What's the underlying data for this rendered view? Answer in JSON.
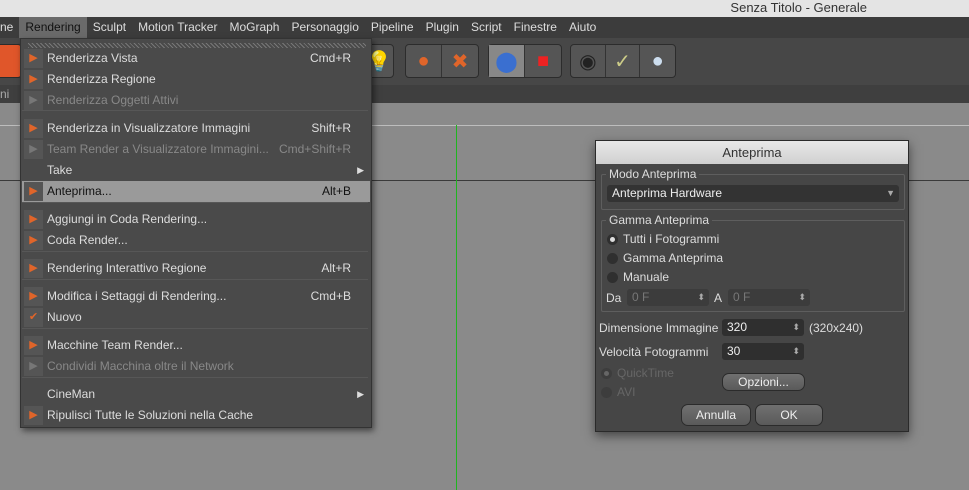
{
  "window": {
    "title": "Senza Titolo - Generale"
  },
  "menubar": [
    "ne",
    "Rendering",
    "Sculpt",
    "Motion Tracker",
    "MoGraph",
    "Personaggio",
    "Pipeline",
    "Plugin",
    "Script",
    "Finestre",
    "Aiuto"
  ],
  "left_tab": "ni",
  "menu": {
    "items": [
      {
        "label": "Renderizza Vista",
        "shortcut": "Cmd+R",
        "icon": "render-view-icon"
      },
      {
        "label": "Renderizza Regione",
        "shortcut": "",
        "icon": "render-region-icon"
      },
      {
        "label": "Renderizza Oggetti Attivi",
        "shortcut": "",
        "icon": "render-active-objects-icon",
        "disabled": true
      },
      {
        "label": "Renderizza in Visualizzatore Immagini",
        "shortcut": "Shift+R",
        "icon": "render-picture-viewer-icon"
      },
      {
        "label": "Team Render  a Visualizzatore Immagini...",
        "shortcut": "Cmd+Shift+R",
        "icon": "team-render-icon",
        "disabled": true
      },
      {
        "label": "Take",
        "shortcut": "",
        "submenu": true
      },
      {
        "label": "Anteprima...",
        "shortcut": "Alt+B",
        "icon": "preview-icon",
        "highlighted": true
      },
      {
        "label": "Aggiungi in Coda Rendering...",
        "shortcut": "",
        "icon": "add-render-queue-icon"
      },
      {
        "label": "Coda Render...",
        "shortcut": "",
        "icon": "render-queue-icon"
      },
      {
        "label": "Rendering Interattivo Regione",
        "shortcut": "Alt+R",
        "icon": "interactive-render-region-icon"
      },
      {
        "label": "Modifica i Settaggi di Rendering...",
        "shortcut": "Cmd+B",
        "icon": "render-settings-icon"
      },
      {
        "label": "Nuovo",
        "shortcut": "",
        "icon": "checkmark-icon"
      },
      {
        "label": "Macchine Team Render...",
        "shortcut": "",
        "icon": "team-render-machines-icon"
      },
      {
        "label": "Condividi Macchina oltre il Network",
        "shortcut": "",
        "icon": "share-machine-icon",
        "disabled": true
      },
      {
        "label": "CineMan",
        "shortcut": "",
        "submenu": true
      },
      {
        "label": "Ripulisci Tutte le Soluzioni nella Cache",
        "shortcut": "",
        "icon": "flush-cache-icon"
      }
    ]
  },
  "dialog": {
    "title": "Anteprima",
    "mode_group": "Modo Anteprima",
    "mode_value": "Anteprima Hardware",
    "range_group": "Gamma Anteprima",
    "range_options": [
      "Tutti i Fotogrammi",
      "Gamma Anteprima",
      "Manuale"
    ],
    "range_selected": 0,
    "from_label": "Da",
    "from_value": "0 F",
    "to_label": "A",
    "to_value": "0 F",
    "size_label": "Dimensione Immagine",
    "size_value": "320",
    "size_info": "(320x240)",
    "fps_label": "Velocità Fotogrammi",
    "fps_value": "30",
    "formats": [
      "QuickTime",
      "AVI"
    ],
    "options_button": "Opzioni...",
    "cancel_button": "Annulla",
    "ok_button": "OK"
  },
  "colors": {
    "axis_y": "#1fb51f",
    "menu_bg": "#4a4a4a",
    "highlight": "#9a9a9a"
  }
}
